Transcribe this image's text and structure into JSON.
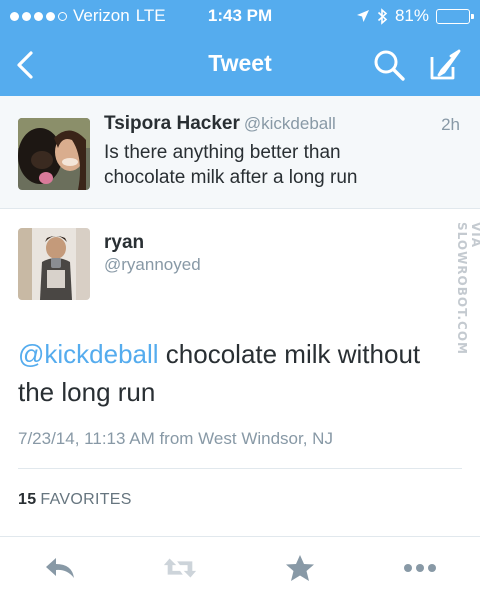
{
  "status_bar": {
    "carrier": "Verizon",
    "network": "LTE",
    "time": "1:43 PM",
    "battery": "81%",
    "battery_level": 0.81
  },
  "nav": {
    "title": "Tweet",
    "back_icon": "chevron-left-icon",
    "search_icon": "search-icon",
    "compose_icon": "compose-icon"
  },
  "reply_to": {
    "name": "Tsipora Hacker",
    "handle": "@kickdeball",
    "time": "2h",
    "text": "Is there anything better than chocolate milk after a long run"
  },
  "tweet": {
    "name": "ryan",
    "handle": "@ryannoyed",
    "mention": "@kickdeball",
    "text": " chocolate milk without the long run",
    "meta": "7/23/14, 11:13 AM from West Windsor, NJ",
    "favorites_count": "15",
    "favorites_label": "FAVORITES"
  },
  "watermark": "VIA SLOWROBOT.COM",
  "actions": [
    "reply-icon",
    "retweet-icon",
    "favorite-icon",
    "more-icon"
  ],
  "colors": {
    "accent": "#55acee",
    "text": "#292f33",
    "muted": "#8899a6",
    "icon": "#8899a6"
  }
}
